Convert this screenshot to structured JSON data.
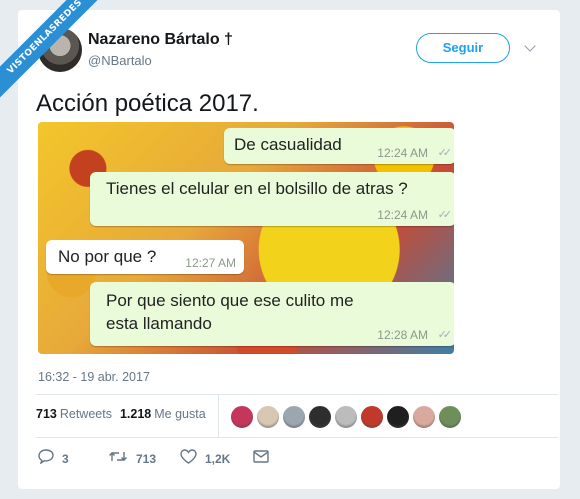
{
  "watermark": "VISTOENLASREDES",
  "author": {
    "name": "Nazareno Bártalo †",
    "handle": "@NBartalo"
  },
  "follow_label": "Seguir",
  "tweet_text": "Acción poética 2017.",
  "chat": [
    {
      "text": "De casualidad",
      "time": "12:24 AM",
      "checks": "✓✓"
    },
    {
      "text": "Tienes el celular en el bolsillo de atras ?",
      "time": "12:24 AM",
      "checks": "✓✓"
    },
    {
      "text": "No por que ?",
      "time": "12:27 AM"
    },
    {
      "text": "Por que siento que ese culito me esta llamando",
      "time": "12:28 AM",
      "checks": "✓✓"
    }
  ],
  "date": "16:32 - 19 abr. 2017",
  "stats": {
    "retweets_count": "713",
    "retweets_label": "Retweets",
    "likes_count": "1.218",
    "likes_label": "Me gusta"
  },
  "likers_colors": [
    "#c6365a",
    "#d8c7b3",
    "#9aa7b0",
    "#2e2e2e",
    "#bcbcbc",
    "#c0392b",
    "#1f1f1f",
    "#d9a9a0",
    "#6f8f5a"
  ],
  "actions": {
    "reply_icon": "reply-icon",
    "reply_count": "3",
    "retweet_icon": "retweet-icon",
    "retweet_count": "713",
    "like_icon": "heart-icon",
    "like_count": "1,2K",
    "dm_icon": "envelope-icon"
  },
  "colors": {
    "accent": "#1da1f2",
    "banner": "#2b8fd6",
    "page_bg": "#e6ecf0"
  }
}
